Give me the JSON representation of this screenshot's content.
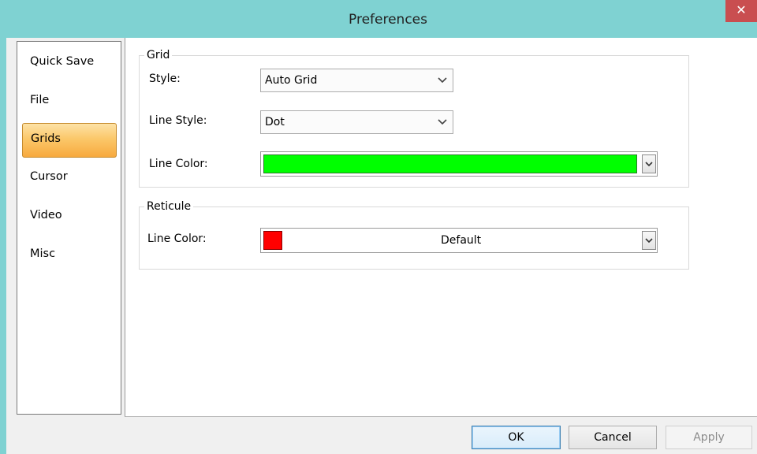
{
  "window": {
    "title": "Preferences",
    "close_glyph": "✕"
  },
  "sidebar": {
    "items": [
      {
        "label": "Quick Save",
        "active": false
      },
      {
        "label": "File",
        "active": false
      },
      {
        "label": "Grids",
        "active": true
      },
      {
        "label": "Cursor",
        "active": false
      },
      {
        "label": "Video",
        "active": false
      },
      {
        "label": "Misc",
        "active": false
      }
    ]
  },
  "grid_group": {
    "legend": "Grid",
    "style_label": "Style:",
    "style_value": "Auto Grid",
    "line_style_label": "Line Style:",
    "line_style_value": "Dot",
    "line_color_label": "Line Color:",
    "line_color": "#00ff00"
  },
  "reticule_group": {
    "legend": "Reticule",
    "line_color_label": "Line Color:",
    "line_color": "#ff0000",
    "line_color_value": "Default"
  },
  "buttons": {
    "ok": "OK",
    "cancel": "Cancel",
    "apply": "Apply"
  },
  "colors": {
    "titlebar": "#7fd2d2",
    "close": "#c94e50",
    "active_item": "#fbc86a"
  }
}
